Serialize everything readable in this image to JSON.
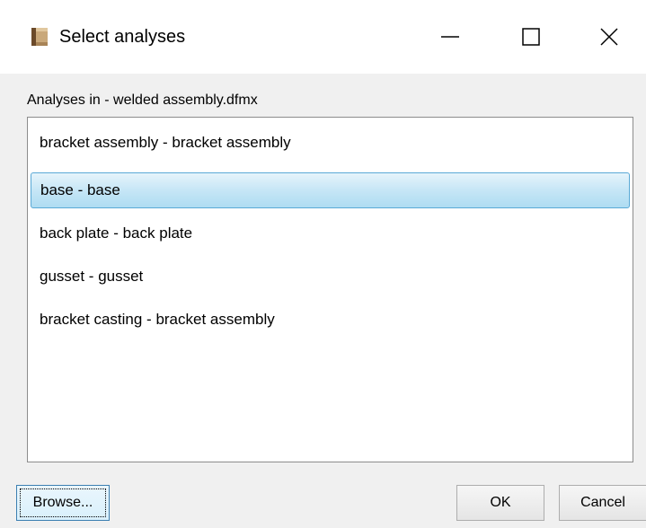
{
  "window": {
    "title": "Select analyses",
    "icon": "app-icon",
    "controls": {
      "minimize_icon": "minimize-icon",
      "maximize_icon": "maximize-icon",
      "close_icon": "close-icon"
    }
  },
  "analyses": {
    "label": "Analyses in - welded assembly.dfmx",
    "items": [
      {
        "label": "bracket assembly - bracket assembly",
        "selected": false
      },
      {
        "label": "base - base",
        "selected": true
      },
      {
        "label": "back plate - back plate",
        "selected": false
      },
      {
        "label": "gusset - gusset",
        "selected": false
      },
      {
        "label": "bracket casting - bracket assembly",
        "selected": false
      }
    ]
  },
  "buttons": {
    "browse": "Browse...",
    "ok": "OK",
    "cancel": "Cancel"
  },
  "colors": {
    "selection_border": "#5aa9d6",
    "selection_fill": "#c6e6f6",
    "dialog_background": "#f0f0f0"
  }
}
